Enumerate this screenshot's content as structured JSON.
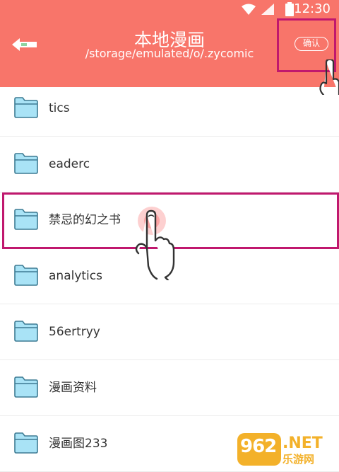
{
  "status_bar": {
    "time": "12:30",
    "icons": [
      "wifi-icon",
      "signal-icon",
      "battery-icon"
    ]
  },
  "header": {
    "title": "本地漫画",
    "path": "/storage/emulated/o/.zycomic",
    "confirm_label": "确认",
    "back_icon": "back-arrow-icon",
    "background_color": "#f8756a"
  },
  "folders": [
    {
      "name": "tics",
      "icon": "folder-icon"
    },
    {
      "name": "eaderc",
      "icon": "folder-icon"
    },
    {
      "name": "禁忌的幻之书",
      "icon": "folder-icon"
    },
    {
      "name": "analytics",
      "icon": "folder-icon"
    },
    {
      "name": "56ertryy",
      "icon": "folder-icon"
    },
    {
      "name": "漫画资料",
      "icon": "folder-icon"
    },
    {
      "name": "漫画图233",
      "icon": "folder-icon"
    }
  ],
  "highlight_color": "#c0186e",
  "watermark": {
    "digits": "962",
    "net": ".NET",
    "site": "乐游网"
  }
}
